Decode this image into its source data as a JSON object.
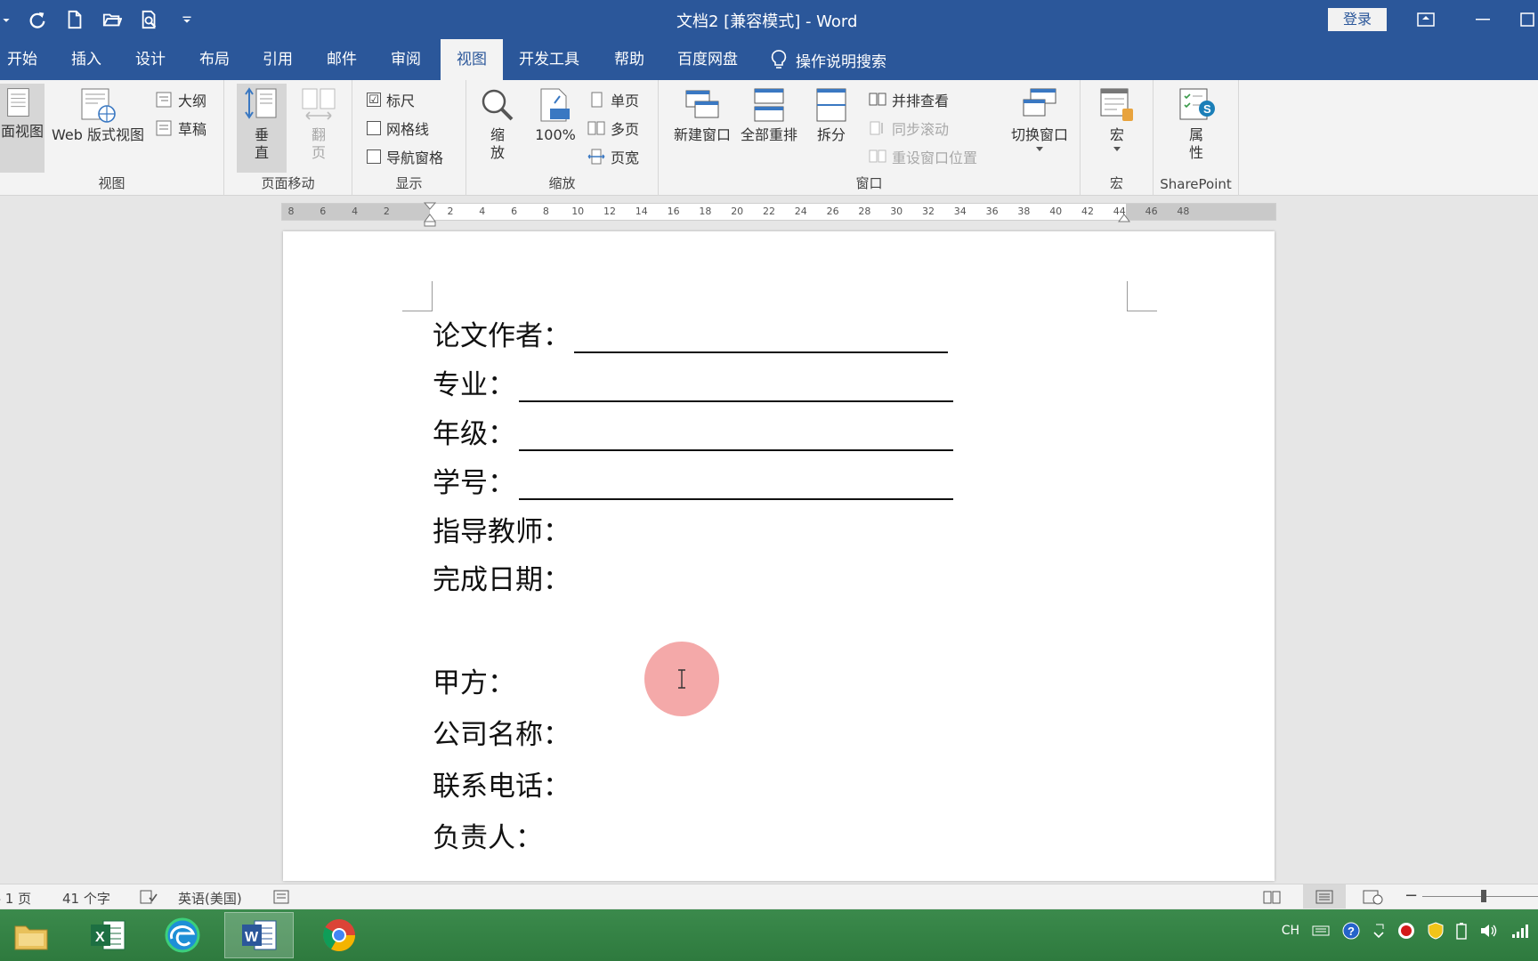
{
  "window": {
    "title": "文档2 [兼容模式]  -  Word",
    "login_label": "登录"
  },
  "tabs": [
    {
      "label": "开始"
    },
    {
      "label": "插入"
    },
    {
      "label": "设计"
    },
    {
      "label": "布局"
    },
    {
      "label": "引用"
    },
    {
      "label": "邮件"
    },
    {
      "label": "审阅"
    },
    {
      "label": "视图",
      "active": true
    },
    {
      "label": "开发工具"
    },
    {
      "label": "帮助"
    },
    {
      "label": "百度网盘"
    }
  ],
  "tell_me": "操作说明搜索",
  "ribbon": {
    "views": {
      "print_layout": "面视图",
      "web_layout": "Web 版式视图",
      "outline": "大纲",
      "draft": "草稿",
      "group_label": "视图"
    },
    "page_movement": {
      "vertical": "垂\n直",
      "side_by_side": "翻\n页",
      "group_label": "页面移动"
    },
    "show": {
      "ruler": "标尺",
      "gridlines": "网格线",
      "nav_pane": "导航窗格",
      "ruler_checked": "☑",
      "group_label": "显示"
    },
    "zoom": {
      "zoom": "缩\n放",
      "hundred": "100%",
      "one_page": "单页",
      "multi_page": "多页",
      "page_width": "页宽",
      "group_label": "缩放"
    },
    "window": {
      "new_window": "新建窗口",
      "arrange_all": "全部重排",
      "split": "拆分",
      "view_side_by_side": "并排查看",
      "sync_scroll": "同步滚动",
      "reset_position": "重设窗口位置",
      "switch_windows": "切换窗口",
      "group_label": "窗口"
    },
    "macros": {
      "macros": "宏",
      "group_label": "宏"
    },
    "sharepoint": {
      "properties": "属\n性",
      "group_label": "SharePoint"
    }
  },
  "ruler_ticks": [
    "8",
    "6",
    "4",
    "2",
    "2",
    "4",
    "6",
    "8",
    "10",
    "12",
    "14",
    "16",
    "18",
    "20",
    "22",
    "24",
    "26",
    "28",
    "30",
    "32",
    "34",
    "36",
    "38",
    "40",
    "42",
    "44",
    "46",
    "48"
  ],
  "document": {
    "lines": [
      {
        "label": "论文作者：",
        "underline": true
      },
      {
        "label": "专业：",
        "underline": true
      },
      {
        "label": "年级：",
        "underline": true
      },
      {
        "label": "学号：",
        "underline": true
      },
      {
        "label": "指导教师："
      },
      {
        "label": "完成日期："
      },
      {
        "label": "甲方："
      },
      {
        "label": "公司名称："
      },
      {
        "label": "联系电话："
      },
      {
        "label": "负责人："
      }
    ]
  },
  "statusbar": {
    "page": "共 1 页",
    "words": "41 个字",
    "language": "英语(美国)"
  },
  "taskbar": {
    "tray_lang": "CH"
  }
}
